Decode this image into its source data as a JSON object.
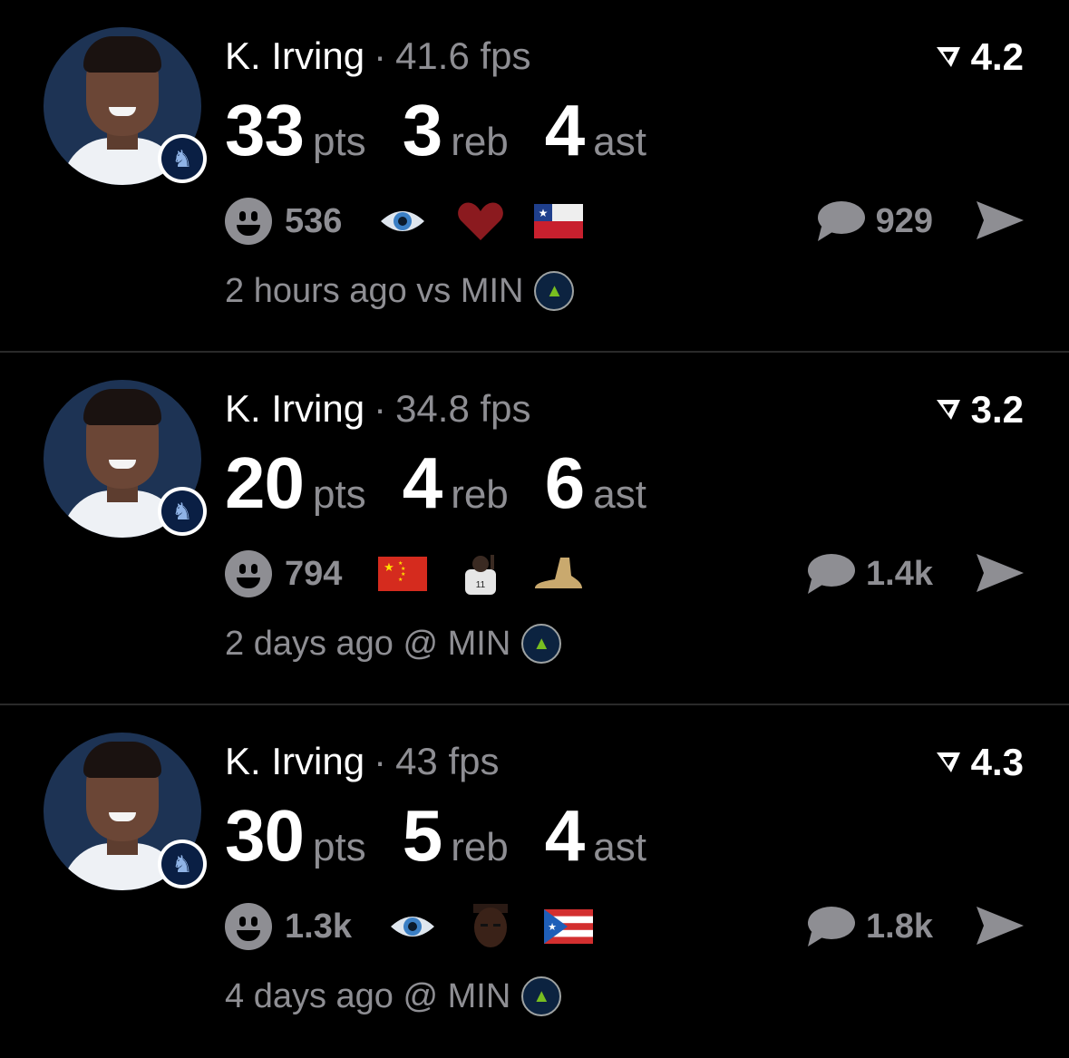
{
  "cards": [
    {
      "player": "K. Irving",
      "separator": "·",
      "fps": "41.6 fps",
      "rating": "4.2",
      "stats": [
        {
          "value": "33",
          "unit": "pts"
        },
        {
          "value": "3",
          "unit": "reb"
        },
        {
          "value": "4",
          "unit": "ast"
        }
      ],
      "reactions_count": "536",
      "emojis": [
        "eye-icon",
        "red-heart-icon",
        "chile-flag-icon"
      ],
      "comments_count": "929",
      "footer_text": "2 hours ago vs MIN"
    },
    {
      "player": "K. Irving",
      "separator": "·",
      "fps": "34.8 fps",
      "rating": "3.2",
      "stats": [
        {
          "value": "20",
          "unit": "pts"
        },
        {
          "value": "4",
          "unit": "reb"
        },
        {
          "value": "6",
          "unit": "ast"
        }
      ],
      "reactions_count": "794",
      "emojis": [
        "china-flag-icon",
        "player-photo-icon",
        "foot-icon"
      ],
      "comments_count": "1.4k",
      "footer_text": "2 days ago @ MIN"
    },
    {
      "player": "K. Irving",
      "separator": "·",
      "fps": "43 fps",
      "rating": "4.3",
      "stats": [
        {
          "value": "30",
          "unit": "pts"
        },
        {
          "value": "5",
          "unit": "reb"
        },
        {
          "value": "4",
          "unit": "ast"
        }
      ],
      "reactions_count": "1.3k",
      "emojis": [
        "eye-icon",
        "face-photo-icon",
        "puerto-rico-flag-icon"
      ],
      "comments_count": "1.8k",
      "footer_text": "4 days ago @ MIN"
    }
  ],
  "colors": {
    "background": "#000000",
    "primary_text": "#ffffff",
    "secondary_text": "#8e8e93",
    "divider": "#2a2a2a"
  }
}
